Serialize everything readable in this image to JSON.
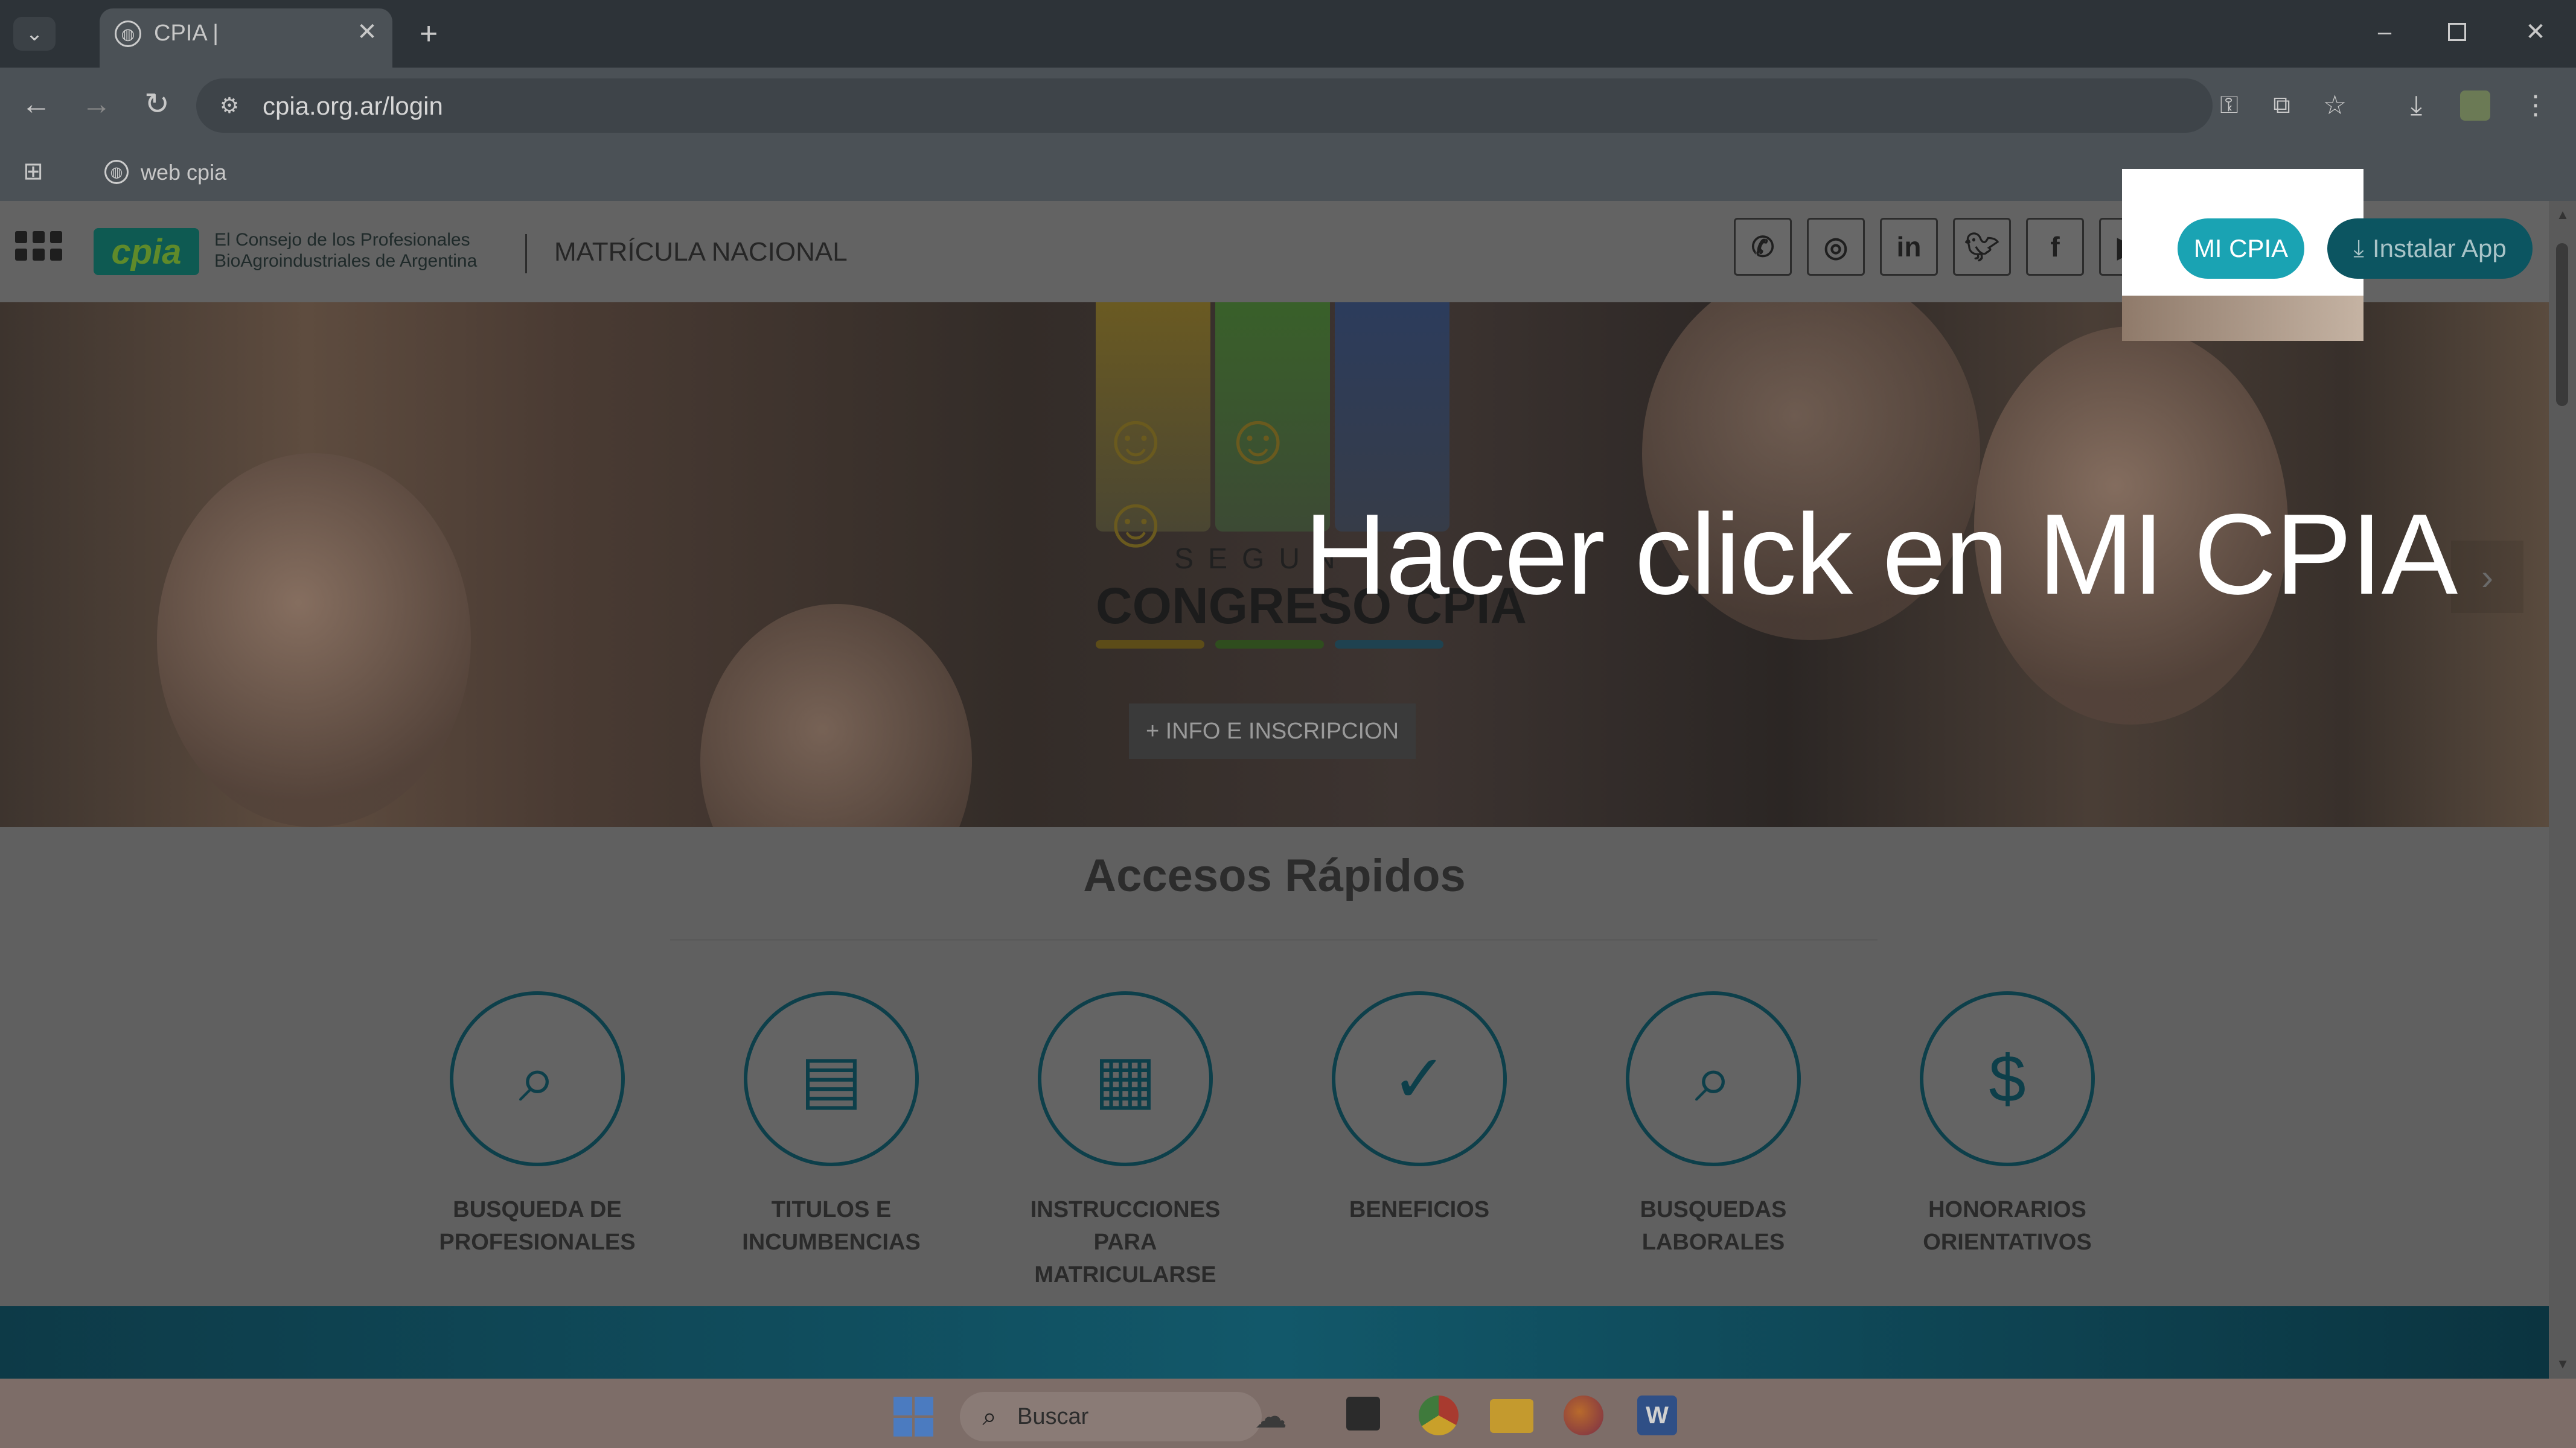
{
  "browser": {
    "tab_title": "CPIA |",
    "url": "cpia.org.ar/login",
    "bookmark": "web cpia",
    "icons": [
      "tab-list-icon",
      "globe-icon",
      "close-icon",
      "plus-icon",
      "minimize-icon",
      "restore-icon",
      "window-close-icon",
      "back-icon",
      "forward-icon",
      "reload-icon",
      "site-settings-icon",
      "key-icon",
      "install-icon",
      "star-icon",
      "download-icon",
      "extension-icon",
      "menu-icon",
      "apps-icon"
    ]
  },
  "site": {
    "logo_text": "cpia",
    "org_line1": "El Consejo de los Profesionales",
    "org_line2": "BioAgroindustriales de Argentina",
    "nav_title": "MATRÍCULA NACIONAL",
    "social": [
      "whatsapp-icon",
      "instagram-icon",
      "linkedin-icon",
      "twitter-icon",
      "facebook-icon",
      "youtube-icon"
    ],
    "mi_cpia": "MI CPIA",
    "install_app": "Instalar App",
    "accent": "#1aa3b3"
  },
  "hero": {
    "event_top": "SEGUN",
    "event_name": "CONGRESO CPIA",
    "cta": "+ INFO E INSCRIPCION",
    "bar_colors": [
      "#c9a21a",
      "#4f8f1d",
      "#2f4d86"
    ]
  },
  "overlay": {
    "instruction": "Hacer click en MI CPIA"
  },
  "quick_access": {
    "title": "Accesos Rápidos",
    "items": [
      {
        "line1": "BUSQUEDA DE",
        "line2": "PROFESIONALES",
        "icon": "search-professional-icon"
      },
      {
        "line1": "TITULOS E",
        "line2": "INCUMBENCIAS",
        "icon": "clipboard-icon"
      },
      {
        "line1": "INSTRUCCIONES PARA",
        "line2": "MATRICULARSE",
        "icon": "document-icon"
      },
      {
        "line1": "BENEFICIOS",
        "line2": "",
        "icon": "checkmark-document-icon"
      },
      {
        "line1": "BUSQUEDAS",
        "line2": "LABORALES",
        "icon": "job-search-icon"
      },
      {
        "line1": "HONORARIOS",
        "line2": "ORIENTATIVOS",
        "icon": "fee-document-icon"
      }
    ]
  },
  "taskbar": {
    "search_placeholder": "Buscar"
  }
}
